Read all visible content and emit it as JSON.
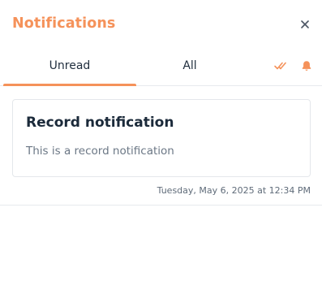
{
  "panel": {
    "title": "Notifications",
    "close_icon": "close-icon"
  },
  "tabs": [
    {
      "label": "Unread",
      "active": true
    },
    {
      "label": "All",
      "active": false
    }
  ],
  "actions": {
    "mark_all_read_icon": "double-check-icon",
    "bell_icon": "bell-icon"
  },
  "notifications": [
    {
      "title": "Record notification",
      "body": "This is a record notification",
      "timestamp": "Tuesday, May 6, 2025 at 12:34 PM"
    }
  ],
  "colors": {
    "accent": "#f5925a",
    "title_text": "#1b2a3a",
    "muted_text": "#6b7785",
    "border": "#e4e7eb"
  }
}
